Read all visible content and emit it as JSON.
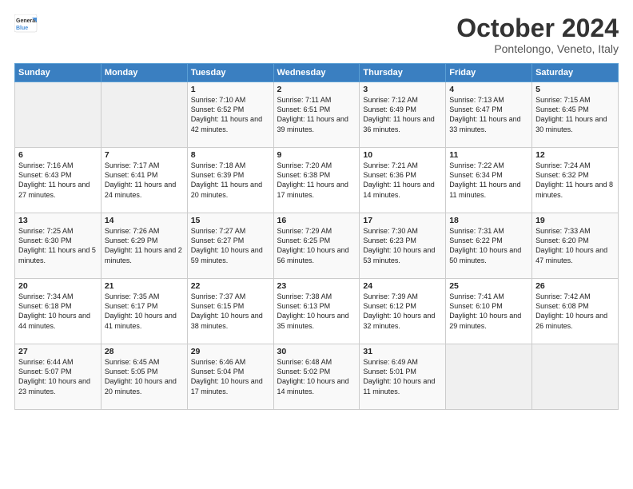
{
  "header": {
    "logo_line1": "General",
    "logo_line2": "Blue",
    "month": "October 2024",
    "location": "Pontelongo, Veneto, Italy"
  },
  "days_of_week": [
    "Sunday",
    "Monday",
    "Tuesday",
    "Wednesday",
    "Thursday",
    "Friday",
    "Saturday"
  ],
  "weeks": [
    [
      {
        "day": "",
        "info": ""
      },
      {
        "day": "",
        "info": ""
      },
      {
        "day": "1",
        "info": "Sunrise: 7:10 AM\nSunset: 6:52 PM\nDaylight: 11 hours and 42 minutes."
      },
      {
        "day": "2",
        "info": "Sunrise: 7:11 AM\nSunset: 6:51 PM\nDaylight: 11 hours and 39 minutes."
      },
      {
        "day": "3",
        "info": "Sunrise: 7:12 AM\nSunset: 6:49 PM\nDaylight: 11 hours and 36 minutes."
      },
      {
        "day": "4",
        "info": "Sunrise: 7:13 AM\nSunset: 6:47 PM\nDaylight: 11 hours and 33 minutes."
      },
      {
        "day": "5",
        "info": "Sunrise: 7:15 AM\nSunset: 6:45 PM\nDaylight: 11 hours and 30 minutes."
      }
    ],
    [
      {
        "day": "6",
        "info": "Sunrise: 7:16 AM\nSunset: 6:43 PM\nDaylight: 11 hours and 27 minutes."
      },
      {
        "day": "7",
        "info": "Sunrise: 7:17 AM\nSunset: 6:41 PM\nDaylight: 11 hours and 24 minutes."
      },
      {
        "day": "8",
        "info": "Sunrise: 7:18 AM\nSunset: 6:39 PM\nDaylight: 11 hours and 20 minutes."
      },
      {
        "day": "9",
        "info": "Sunrise: 7:20 AM\nSunset: 6:38 PM\nDaylight: 11 hours and 17 minutes."
      },
      {
        "day": "10",
        "info": "Sunrise: 7:21 AM\nSunset: 6:36 PM\nDaylight: 11 hours and 14 minutes."
      },
      {
        "day": "11",
        "info": "Sunrise: 7:22 AM\nSunset: 6:34 PM\nDaylight: 11 hours and 11 minutes."
      },
      {
        "day": "12",
        "info": "Sunrise: 7:24 AM\nSunset: 6:32 PM\nDaylight: 11 hours and 8 minutes."
      }
    ],
    [
      {
        "day": "13",
        "info": "Sunrise: 7:25 AM\nSunset: 6:30 PM\nDaylight: 11 hours and 5 minutes."
      },
      {
        "day": "14",
        "info": "Sunrise: 7:26 AM\nSunset: 6:29 PM\nDaylight: 11 hours and 2 minutes."
      },
      {
        "day": "15",
        "info": "Sunrise: 7:27 AM\nSunset: 6:27 PM\nDaylight: 10 hours and 59 minutes."
      },
      {
        "day": "16",
        "info": "Sunrise: 7:29 AM\nSunset: 6:25 PM\nDaylight: 10 hours and 56 minutes."
      },
      {
        "day": "17",
        "info": "Sunrise: 7:30 AM\nSunset: 6:23 PM\nDaylight: 10 hours and 53 minutes."
      },
      {
        "day": "18",
        "info": "Sunrise: 7:31 AM\nSunset: 6:22 PM\nDaylight: 10 hours and 50 minutes."
      },
      {
        "day": "19",
        "info": "Sunrise: 7:33 AM\nSunset: 6:20 PM\nDaylight: 10 hours and 47 minutes."
      }
    ],
    [
      {
        "day": "20",
        "info": "Sunrise: 7:34 AM\nSunset: 6:18 PM\nDaylight: 10 hours and 44 minutes."
      },
      {
        "day": "21",
        "info": "Sunrise: 7:35 AM\nSunset: 6:17 PM\nDaylight: 10 hours and 41 minutes."
      },
      {
        "day": "22",
        "info": "Sunrise: 7:37 AM\nSunset: 6:15 PM\nDaylight: 10 hours and 38 minutes."
      },
      {
        "day": "23",
        "info": "Sunrise: 7:38 AM\nSunset: 6:13 PM\nDaylight: 10 hours and 35 minutes."
      },
      {
        "day": "24",
        "info": "Sunrise: 7:39 AM\nSunset: 6:12 PM\nDaylight: 10 hours and 32 minutes."
      },
      {
        "day": "25",
        "info": "Sunrise: 7:41 AM\nSunset: 6:10 PM\nDaylight: 10 hours and 29 minutes."
      },
      {
        "day": "26",
        "info": "Sunrise: 7:42 AM\nSunset: 6:08 PM\nDaylight: 10 hours and 26 minutes."
      }
    ],
    [
      {
        "day": "27",
        "info": "Sunrise: 6:44 AM\nSunset: 5:07 PM\nDaylight: 10 hours and 23 minutes."
      },
      {
        "day": "28",
        "info": "Sunrise: 6:45 AM\nSunset: 5:05 PM\nDaylight: 10 hours and 20 minutes."
      },
      {
        "day": "29",
        "info": "Sunrise: 6:46 AM\nSunset: 5:04 PM\nDaylight: 10 hours and 17 minutes."
      },
      {
        "day": "30",
        "info": "Sunrise: 6:48 AM\nSunset: 5:02 PM\nDaylight: 10 hours and 14 minutes."
      },
      {
        "day": "31",
        "info": "Sunrise: 6:49 AM\nSunset: 5:01 PM\nDaylight: 10 hours and 11 minutes."
      },
      {
        "day": "",
        "info": ""
      },
      {
        "day": "",
        "info": ""
      }
    ]
  ]
}
